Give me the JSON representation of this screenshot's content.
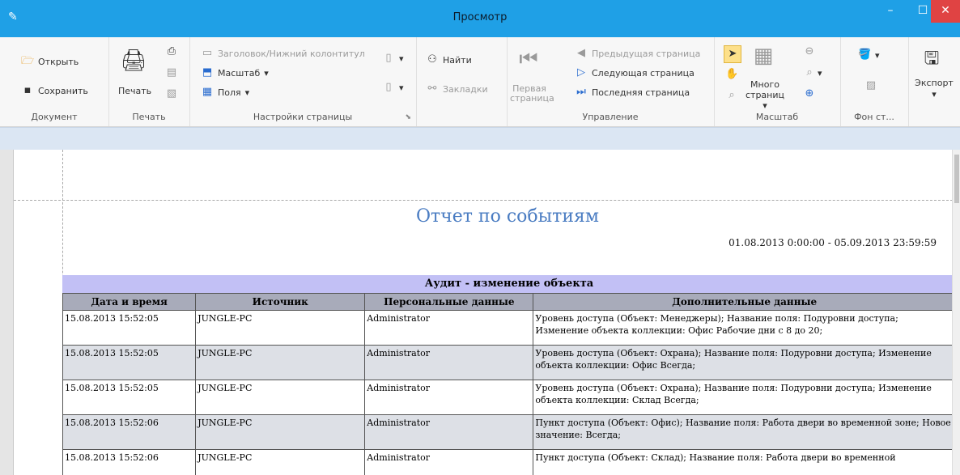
{
  "window": {
    "title": "Просмотр"
  },
  "ribbon": {
    "document": {
      "label": "Документ",
      "open": "Открыть",
      "save": "Сохранить"
    },
    "print": {
      "label": "Печать",
      "print": "Печать"
    },
    "page_settings": {
      "label": "Настройки страницы",
      "header_footer": "Заголовок/Нижний колонтитул",
      "scale": "Масштаб",
      "margins": "Поля"
    },
    "find": {
      "find": "Найти",
      "bookmarks": "Закладки"
    },
    "navigation": {
      "label": "Управление",
      "first_page": "Первая\nстраница",
      "first_line1": "Первая",
      "first_line2": "страница",
      "prev": "Предыдущая страница",
      "next": "Следующая страница",
      "last": "Последняя страница"
    },
    "zoom": {
      "label": "Масштаб",
      "many": "Много",
      "pages": "страниц"
    },
    "background": {
      "label": "Фон ст..."
    },
    "export": {
      "label": "Экспорт"
    }
  },
  "report": {
    "title": "Отчет по событиям",
    "period": "01.08.2013 0:00:00 - 05.09.2013 23:59:59",
    "section": "Аудит - изменение объекта",
    "columns": [
      "Дата и время",
      "Источник",
      "Персональные данные",
      "Дополнительные данные"
    ],
    "rows": [
      [
        "15.08.2013 15:52:05",
        "JUNGLE-PC",
        "Administrator",
        "Уровень доступа (Объект: Менеджеры); Название поля: Подуровни доступа; Изменение объекта коллекции: Офис Рабочие дни с 8 до 20;"
      ],
      [
        "15.08.2013 15:52:05",
        "JUNGLE-PC",
        "Administrator",
        "Уровень доступа (Объект: Охрана); Название поля: Подуровни доступа; Изменение объекта коллекции: Офис Всегда;"
      ],
      [
        "15.08.2013 15:52:05",
        "JUNGLE-PC",
        "Administrator",
        "Уровень доступа (Объект: Охрана); Название поля: Подуровни доступа; Изменение объекта коллекции: Склад Всегда;"
      ],
      [
        "15.08.2013 15:52:06",
        "JUNGLE-PC",
        "Administrator",
        "Пункт доступа (Объект: Офис); Название поля: Работа двери во временной зоне; Новое значение: Всегда;"
      ],
      [
        "15.08.2013 15:52:06",
        "JUNGLE-PC",
        "Administrator",
        "Пункт доступа (Объект: Склад); Название поля: Работа двери во временной"
      ]
    ]
  }
}
